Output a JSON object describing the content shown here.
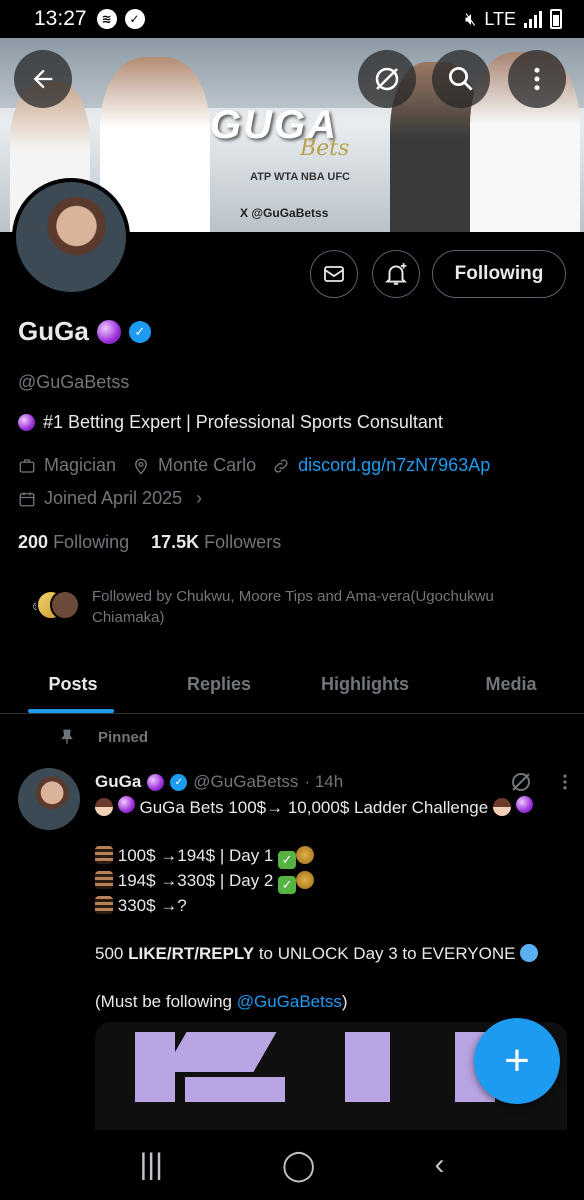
{
  "status_bar": {
    "time": "13:27",
    "network": "LTE"
  },
  "banner": {
    "brand": "GUGA",
    "brand_sub": "Bets",
    "leagues": "ATP WTA NBA UFC",
    "handle": "X @GuGaBetss"
  },
  "profile": {
    "name": "GuGa",
    "handle": "@GuGaBetss",
    "bio": "#1 Betting Expert | Professional Sports Consultant",
    "occupation": "Magician",
    "location": "Monte Carlo",
    "link": "discord.gg/n7zN7963Ap",
    "joined": "Joined April 2025",
    "following_count": "200",
    "following_label": "Following",
    "followers_count": "17.5K",
    "followers_label": "Followers",
    "followed_by": "Followed by Chukwu, Moore Tips and Ama-vera(Ugochukwu Chiamaka)"
  },
  "actions": {
    "follow_label": "Following"
  },
  "tabs": [
    {
      "label": "Posts",
      "active": true
    },
    {
      "label": "Replies",
      "active": false
    },
    {
      "label": "Highlights",
      "active": false
    },
    {
      "label": "Media",
      "active": false
    }
  ],
  "pinned_label": "Pinned",
  "post": {
    "name": "GuGa",
    "handle": "@GuGaBetss",
    "time": "· 14h",
    "title": "GuGa Bets 100$→ 10,000$ Ladder Challenge",
    "line1": "100$ →194$ | Day 1",
    "line2": "194$ →330$ | Day 2",
    "line3": "330$ →?",
    "cta_prefix": "500 ",
    "cta_like": "LIKE",
    "cta_slash1": "/",
    "cta_rt": "RT",
    "cta_slash2": "/",
    "cta_reply": "REPLY",
    "cta_suffix": " to UNLOCK Day 3 to EVERYONE",
    "note_prefix": "(Must be following ",
    "note_mention": "@GuGaBetss",
    "note_suffix": ")"
  },
  "colors": {
    "accent": "#1d9bf0",
    "background": "#000000",
    "muted": "#71767b"
  },
  "icons": [
    "back-arrow-icon",
    "grok-icon",
    "search-icon",
    "more-icon",
    "message-icon",
    "notification-bell-icon",
    "briefcase-icon",
    "location-icon",
    "link-icon",
    "calendar-icon",
    "pin-icon",
    "compose-plus-icon"
  ]
}
